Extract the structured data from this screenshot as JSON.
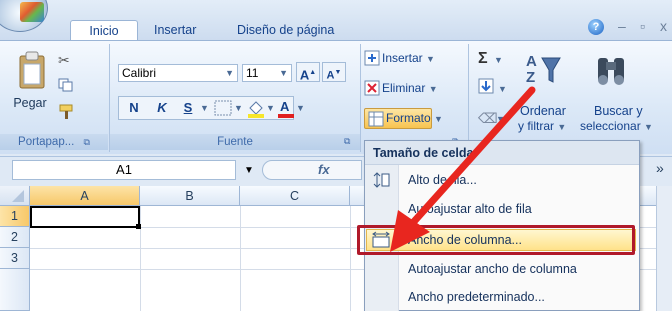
{
  "tabs": {
    "inicio": "Inicio",
    "insertar": "Insertar",
    "diseno": "Diseño de página"
  },
  "help_glyph": "?",
  "window_controls": {
    "minimize": "–",
    "restore": "▫",
    "close": "x"
  },
  "clipboard": {
    "pegar": "Pegar",
    "group_label": "Portapap...",
    "dialog_launcher": "⧉"
  },
  "font": {
    "name": "Calibri",
    "size": "11",
    "grow": "A",
    "shrink": "A",
    "bold": "N",
    "italic": "K",
    "underline": "S",
    "group_label": "Fuente",
    "dialog_launcher": "⧉"
  },
  "cells": {
    "insertar": "Insertar",
    "eliminar": "Eliminar",
    "formato": "Formato",
    "dialog_launcher": "⧉"
  },
  "editing": {
    "sigma": "Σ",
    "ordenar": "Ordenar",
    "y_filtrar": "y filtrar",
    "buscar": "Buscar y",
    "seleccionar": "seleccionar"
  },
  "formula_bar": {
    "name_box": "A1",
    "fx": "fx"
  },
  "sheet": {
    "columns": [
      "A",
      "B",
      "C"
    ],
    "rows": [
      "1",
      "2",
      "3"
    ]
  },
  "menu": {
    "header": "Tamaño de celda",
    "items": [
      "Alto de fila...",
      "Autoajustar alto de fila",
      "Ancho de columna...",
      "Autoajustar ancho de columna",
      "Ancho predeterminado..."
    ],
    "highlighted_index": 2
  },
  "colors": {
    "highlight_border": "#b0192a",
    "arrow": "#e8261f",
    "hover_fill": "#ffe28a"
  }
}
